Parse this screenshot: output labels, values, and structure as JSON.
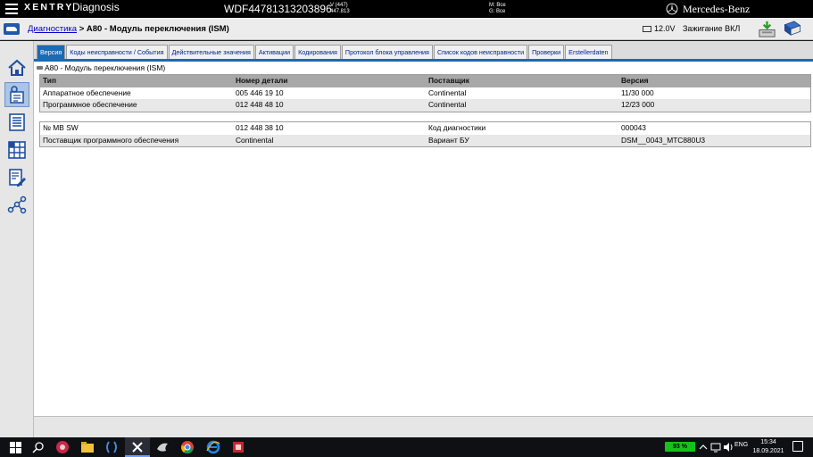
{
  "titlebar": {
    "brand": "XENTRY",
    "app_name": "Diagnosis",
    "vin": "WDF44781313203896",
    "version_line1": "V (447)",
    "version_line2": "447.813",
    "mg_line1": "M: Все",
    "mg_line2": "G: Все",
    "mb_text": "Mercedes-Benz"
  },
  "toolbar": {
    "breadcrumb_link": "Диагностика",
    "breadcrumb_sep": " > ",
    "breadcrumb_current": "A80 - Модуль переключения (ISM)",
    "voltage": "12.0V",
    "ignition": "Зажигание ВКЛ"
  },
  "sidebar": {
    "items": [
      {
        "name": "home-icon",
        "active": false
      },
      {
        "name": "diagnosis-icon",
        "active": true
      },
      {
        "name": "list-icon",
        "active": false
      },
      {
        "name": "grid-icon",
        "active": false
      },
      {
        "name": "document-edit-icon",
        "active": false
      },
      {
        "name": "network-icon",
        "active": false
      }
    ]
  },
  "tabs": [
    {
      "label": "Версия",
      "active": true
    },
    {
      "label": "Коды неисправности / События",
      "active": false
    },
    {
      "label": "Действительные значения",
      "active": false
    },
    {
      "label": "Активации",
      "active": false
    },
    {
      "label": "Кодирования",
      "active": false
    },
    {
      "label": "Протокол блока управления",
      "active": false
    },
    {
      "label": "Список кодов неисправности",
      "active": false
    },
    {
      "label": "Проверки",
      "active": false
    },
    {
      "label": "Erstellerdaten",
      "active": false
    }
  ],
  "content": {
    "module_title": "A80 - Модуль переключения (ISM)",
    "table1": {
      "headers": [
        "Тип",
        "Номер детали",
        "Поставщик",
        "Версия"
      ],
      "rows": [
        [
          "Аппаратное обеспечение",
          "005 446 19 10",
          "Continental",
          "11/30 000"
        ],
        [
          "Программное обеспечение",
          "012 448 48 10",
          "Continental",
          "12/23 000"
        ]
      ]
    },
    "table2": {
      "rows": [
        [
          "№ MB SW",
          "012 448 38 10",
          "Код диагностики",
          "000043"
        ],
        [
          "Поставщик программного обеспечения",
          "Continental",
          "Вариант БУ",
          "DSM__0043_MTC880U3"
        ]
      ]
    }
  },
  "taskbar": {
    "battery_text": "93 %",
    "language": "ENG",
    "time": "15:34",
    "date": "18.09.2021"
  },
  "colors": {
    "accent": "#1b6ab4",
    "link": "#0000c8",
    "header_row": "#a8a8a8",
    "alt_row": "#e8e8e8",
    "battery_green": "#13c413"
  }
}
